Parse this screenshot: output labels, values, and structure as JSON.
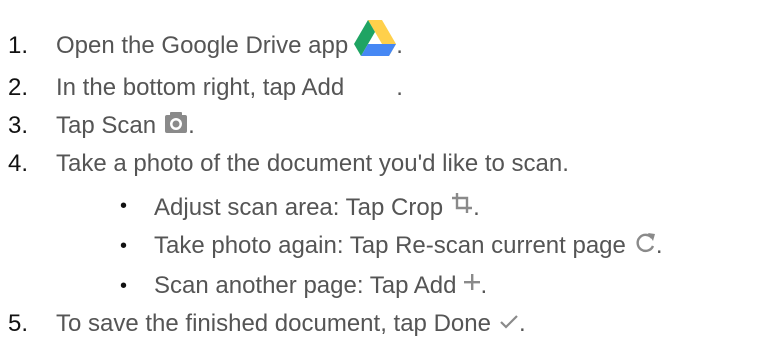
{
  "steps": [
    {
      "number": "1.",
      "text": "Open the Google Drive app",
      "icon": "google-drive-icon",
      "suffix": "."
    },
    {
      "number": "2.",
      "text": "In the bottom right, tap Add",
      "icon": "",
      "suffix": "."
    },
    {
      "number": "3.",
      "text": "Tap Scan",
      "icon": "camera-icon",
      "suffix": "."
    },
    {
      "number": "4.",
      "text": "Take a photo of the document you'd like to scan.",
      "icon": "",
      "suffix": ""
    },
    {
      "number": "5.",
      "text": "To save the finished document, tap Done",
      "icon": "checkmark-icon",
      "suffix": "."
    }
  ],
  "substeps": [
    {
      "bullet": "•",
      "text": "Adjust scan area: Tap Crop",
      "icon": "crop-icon",
      "suffix": "."
    },
    {
      "bullet": "•",
      "text": "Take photo again: Tap Re-scan current page",
      "icon": "refresh-icon",
      "suffix": "."
    },
    {
      "bullet": "•",
      "text": "Scan another page: Tap Add",
      "icon": "plus-icon",
      "suffix": "."
    }
  ],
  "colors": {
    "text": "#555555",
    "number": "#111111",
    "icon_gray": "#8a8a8a",
    "drive_green": "#1fa463",
    "drive_yellow": "#ffd04b",
    "drive_blue": "#4688f4"
  }
}
